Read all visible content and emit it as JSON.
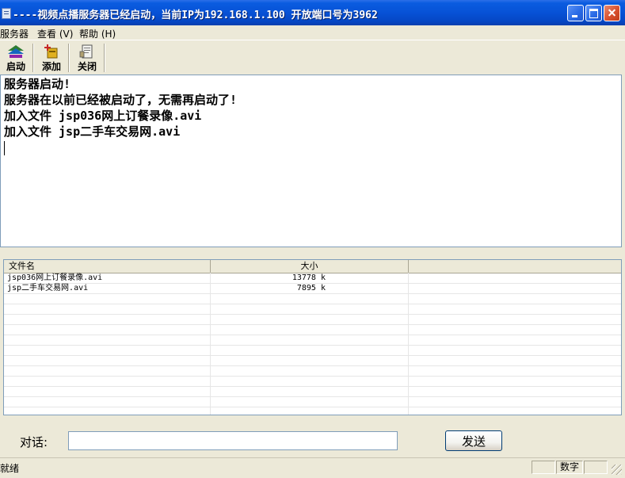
{
  "window": {
    "title": "----视频点播服务器已经启动，当前IP为192.168.1.100 开放端口号为3962"
  },
  "menu": {
    "items": [
      "服务器",
      "查看 (V)",
      "帮助 (H)"
    ]
  },
  "toolbar": {
    "buttons": [
      {
        "label": "启动",
        "icon": "start-icon"
      },
      {
        "label": "添加",
        "icon": "add-icon"
      },
      {
        "label": "关闭",
        "icon": "close-doc-icon"
      }
    ]
  },
  "log": {
    "lines": [
      "服务器启动!",
      "服务器在以前已经被启动了，无需再启动了!",
      "加入文件 jsp036网上订餐录像.avi",
      "加入文件 jsp二手车交易网.avi"
    ]
  },
  "filelist": {
    "columns": [
      "文件名",
      "大小",
      ""
    ],
    "rows": [
      {
        "name": "jsp036网上订餐录像.avi",
        "size": "13778 k"
      },
      {
        "name": "jsp二手车交易网.avi",
        "size": "7895 k"
      }
    ]
  },
  "chat": {
    "label": "对话:",
    "value": "",
    "send_label": "发送"
  },
  "status": {
    "text": "就绪",
    "mode": "数字"
  }
}
